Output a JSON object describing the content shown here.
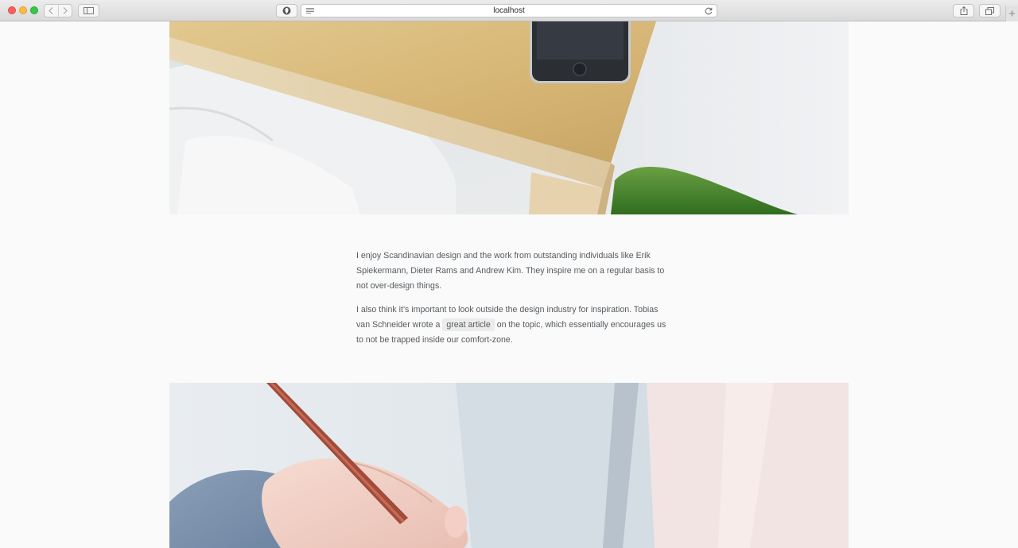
{
  "browser": {
    "address": "localhost",
    "new_tab_label": "+"
  },
  "article": {
    "p1": "I enjoy Scandinavian design and the work from outstanding individuals like Erik Spiekermann, Dieter Rams and Andrew Kim. They inspire me on a regular basis to not over-design things.",
    "p2_before": "I also think it’s important to look outside the design industry for inspiration. Tobias van Schneider wrote a",
    "p2_link": "great article",
    "p2_after": "on the topic, which essentially encourages us to not be trapped inside our comfort-zone."
  },
  "colors": {
    "page_background": "#fafafa",
    "text": "#555b60",
    "link_background": "#ececec"
  }
}
